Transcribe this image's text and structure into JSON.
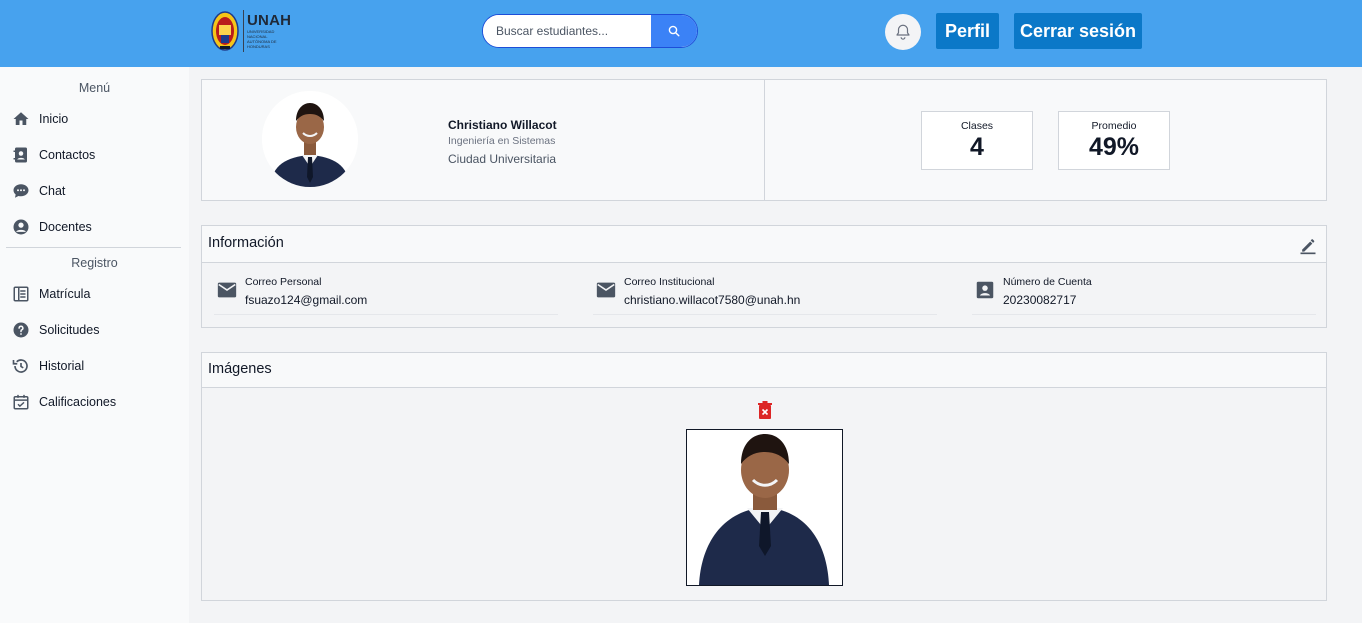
{
  "header": {
    "logo_text": "UNAH",
    "logo_subtext": "UNIVERSIDAD NACIONAL AUTÓNOMA DE HONDURAS",
    "search_placeholder": "Buscar estudiantes...",
    "perfil_label": "Perfil",
    "logout_label": "Cerrar sesión"
  },
  "sidebar": {
    "menu_heading": "Menú",
    "menu_items": [
      {
        "label": "Inicio",
        "icon": "home-icon"
      },
      {
        "label": "Contactos",
        "icon": "contacts-icon"
      },
      {
        "label": "Chat",
        "icon": "chat-icon"
      },
      {
        "label": "Docentes",
        "icon": "user-circle-icon"
      }
    ],
    "registro_heading": "Registro",
    "registro_items": [
      {
        "label": "Matrícula",
        "icon": "list-icon"
      },
      {
        "label": "Solicitudes",
        "icon": "help-icon"
      },
      {
        "label": "Historial",
        "icon": "history-icon"
      },
      {
        "label": "Calificaciones",
        "icon": "calendar-icon"
      }
    ]
  },
  "profile": {
    "name": "Christiano Willacot",
    "career": "Ingeniería en Sistemas",
    "campus": "Ciudad Universitaria"
  },
  "stats": {
    "clases_label": "Clases",
    "clases_value": "4",
    "promedio_label": "Promedio",
    "promedio_value": "49%"
  },
  "info": {
    "title": "Información",
    "items": [
      {
        "label": "Correo Personal",
        "value": "fsuazo124@gmail.com",
        "icon": "mail-icon"
      },
      {
        "label": "Correo Institucional",
        "value": "christiano.willacot7580@unah.hn",
        "icon": "mail-icon"
      },
      {
        "label": "Número de Cuenta",
        "value": "20230082717",
        "icon": "id-card-icon"
      }
    ]
  },
  "images": {
    "title": "Imágenes"
  },
  "colors": {
    "header": "#47a2ee",
    "button": "#0b78c8",
    "search_button": "#3b82f6",
    "trash": "#dc2626"
  }
}
